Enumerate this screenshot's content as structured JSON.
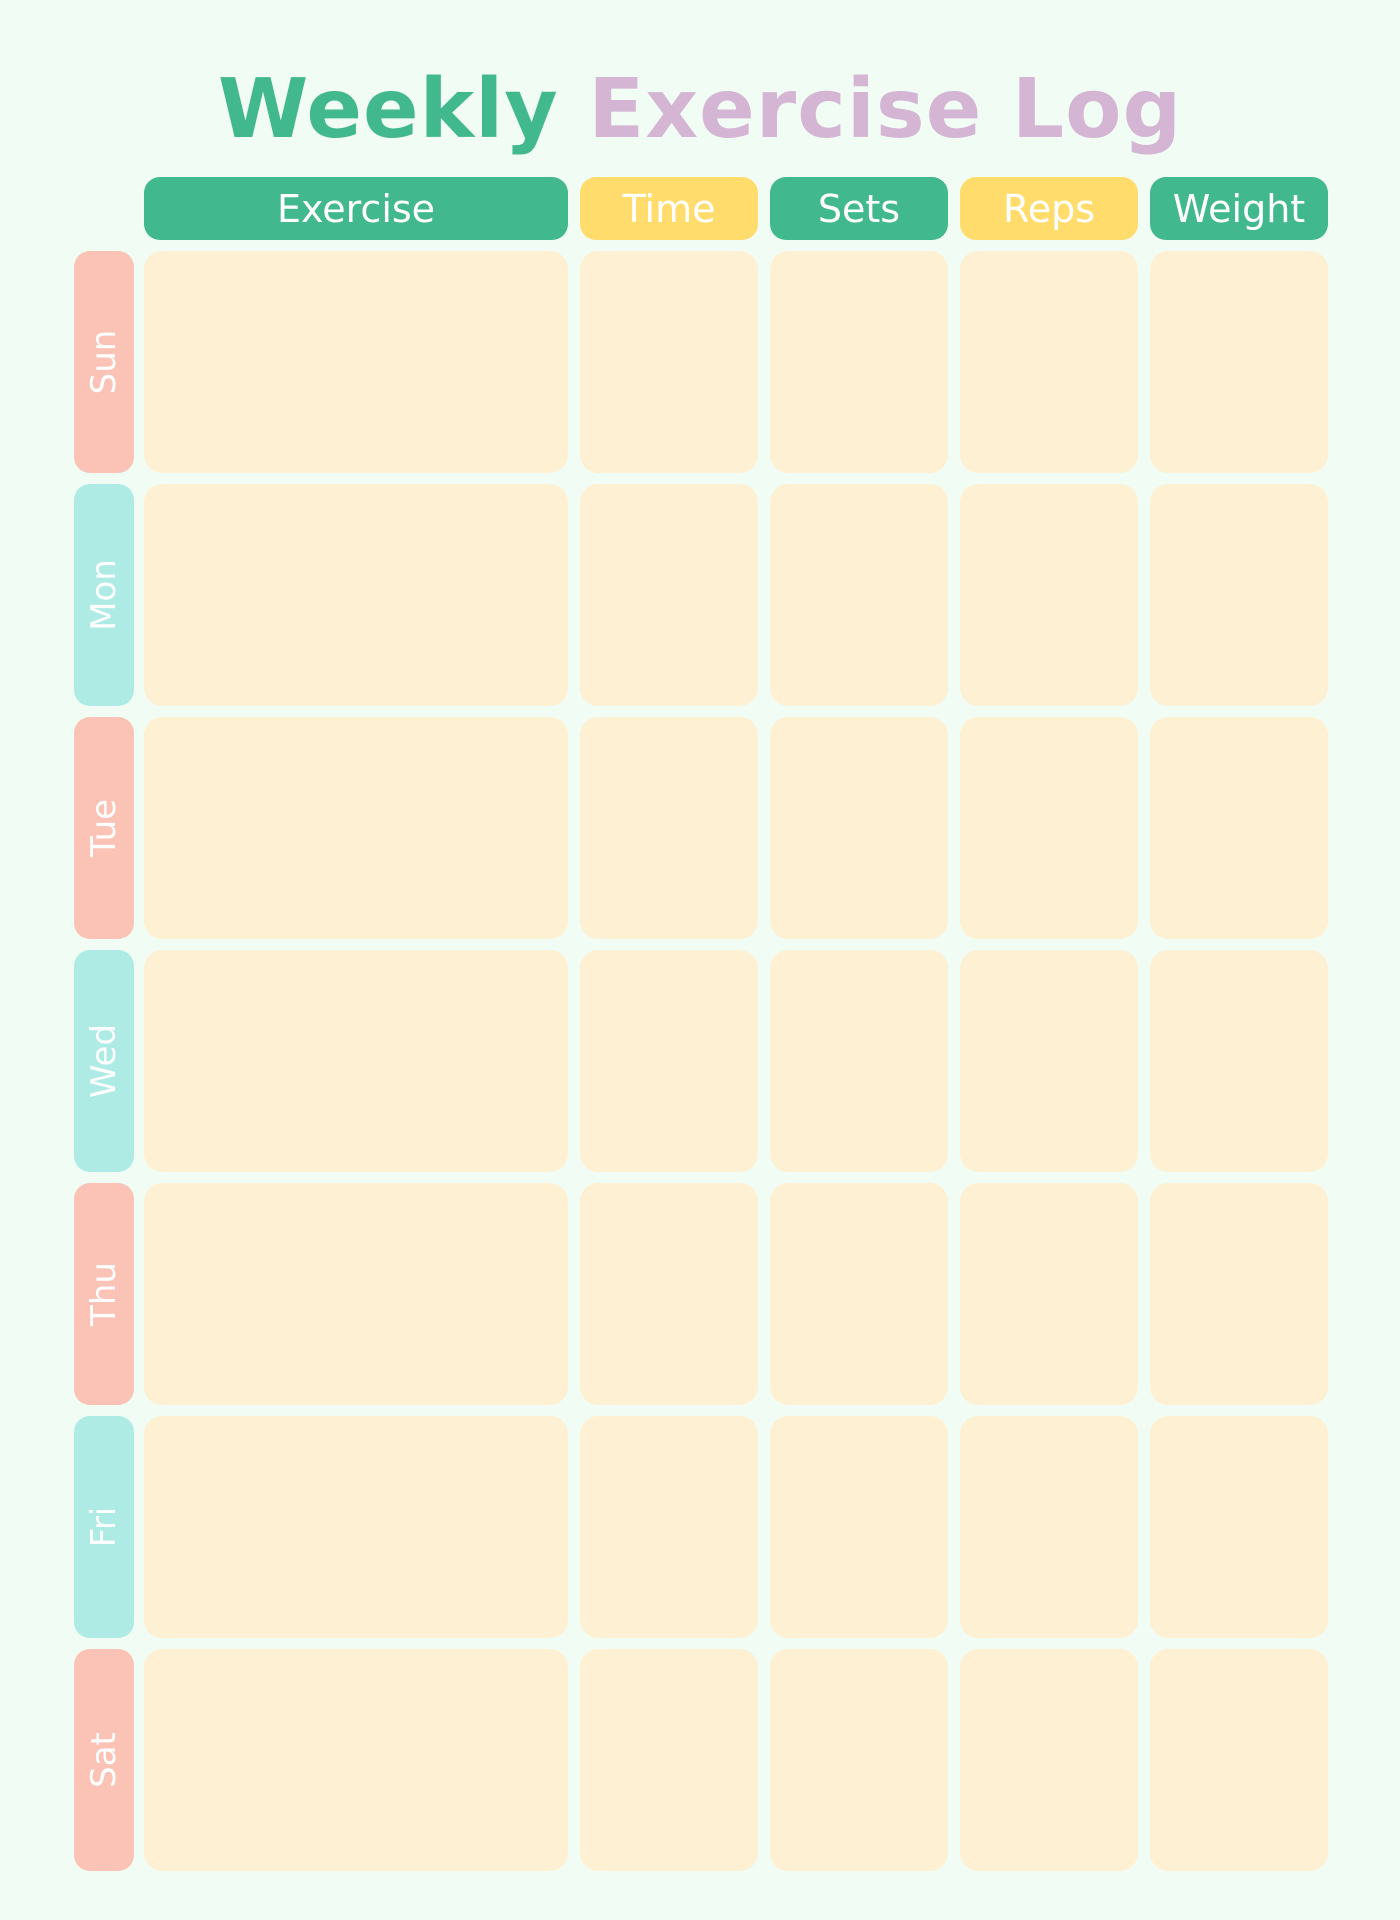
{
  "title": {
    "part1": "Weekly",
    "part2": "Exercise Log"
  },
  "columns": [
    {
      "label": "Exercise",
      "color": "#41b88d"
    },
    {
      "label": "Time",
      "color": "#ffdc6c"
    },
    {
      "label": "Sets",
      "color": "#41b88d"
    },
    {
      "label": "Reps",
      "color": "#ffdc6c"
    },
    {
      "label": "Weight",
      "color": "#41b88d"
    }
  ],
  "days": [
    {
      "label": "Sun",
      "color": "#fbc3b6"
    },
    {
      "label": "Mon",
      "color": "#aeebe5"
    },
    {
      "label": "Tue",
      "color": "#fbc3b6"
    },
    {
      "label": "Wed",
      "color": "#aeebe5"
    },
    {
      "label": "Thu",
      "color": "#fbc3b6"
    },
    {
      "label": "Fri",
      "color": "#aeebe5"
    },
    {
      "label": "Sat",
      "color": "#fbc3b6"
    }
  ],
  "colors": {
    "background": "#f1fdf4",
    "title_primary": "#41b88d",
    "title_secondary": "#d4b5d3",
    "cell": "#fef0d2"
  }
}
